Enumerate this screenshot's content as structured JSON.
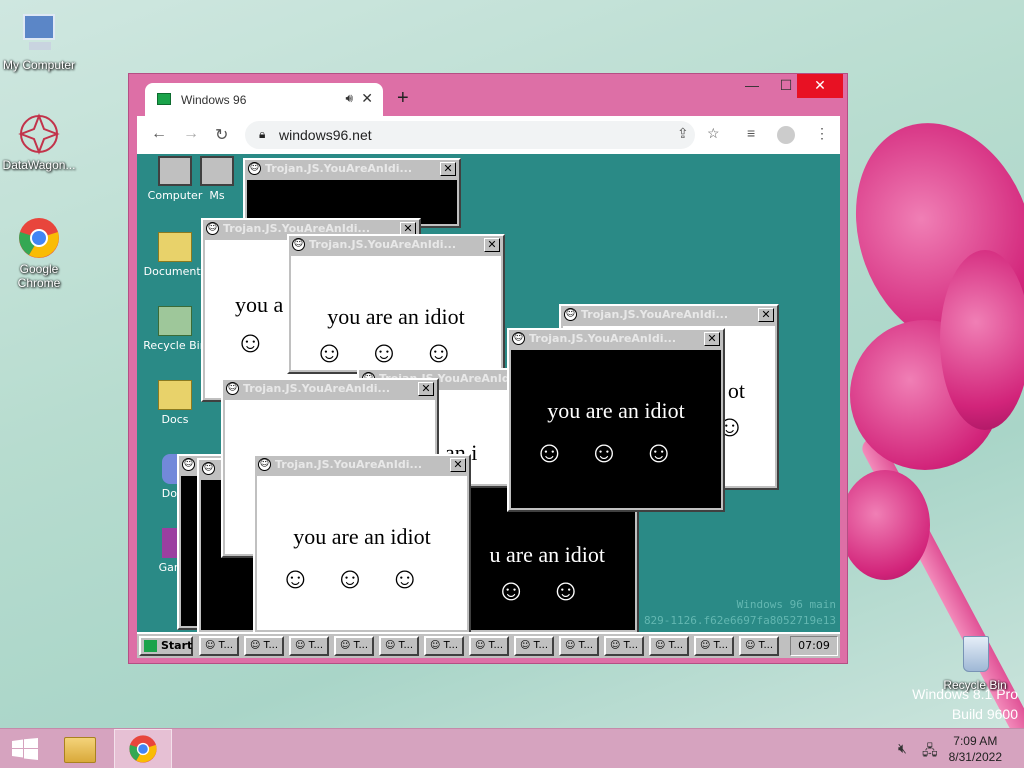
{
  "desktop": {
    "icons": [
      {
        "label": "My Computer"
      },
      {
        "label": "DataWagon..."
      },
      {
        "label": "Google Chrome"
      },
      {
        "label": "Recycle Bin"
      }
    ],
    "watermark_line1": "Windows 8.1 Pro",
    "watermark_line2": "Build 9600"
  },
  "browser": {
    "tab_title": "Windows 96",
    "audio_icon": "speaker-icon",
    "url": "windows96.net",
    "controls": {
      "minimize": "—",
      "maximize": "☐",
      "close": "✕"
    }
  },
  "win96": {
    "icons": [
      {
        "label": "Computer"
      },
      {
        "label": "Ms"
      },
      {
        "label": "Documents"
      },
      {
        "label": "Recycle Bin"
      },
      {
        "label": "Docs"
      },
      {
        "label": "Door"
      },
      {
        "label": "Game"
      }
    ],
    "popup_title": "Trojan.JS.YouAreAnIdi...",
    "popup_message": "you are an idiot",
    "popup_message_cut1": "you a",
    "popup_message_cut2": "u are an idiot",
    "popup_message_cut3": "ot",
    "popup_message_cut4": "an i",
    "smiley": "☺",
    "watermark_line1": "Windows 96 main",
    "watermark_line2": "829-1126.f62e6697fa8052719e13",
    "start_label": "Start",
    "task_label": "T...",
    "clock": "07:09"
  },
  "taskbar": {
    "time": "7:09 AM",
    "date": "8/31/2022"
  }
}
